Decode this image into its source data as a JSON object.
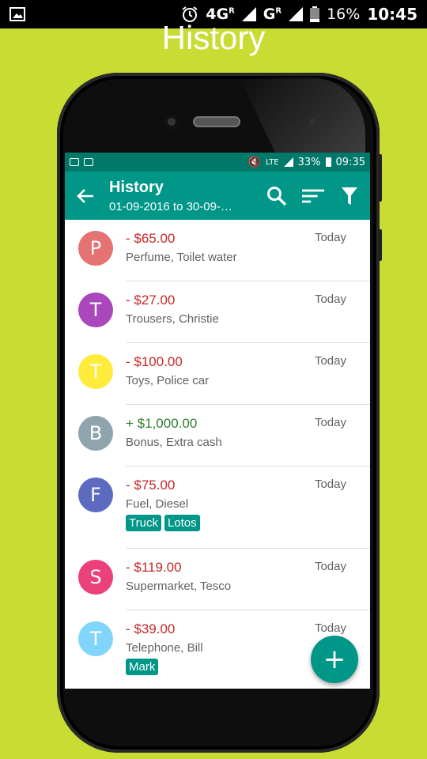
{
  "os_status": {
    "network_1": "4G",
    "network_1_sup": "R",
    "network_2": "G",
    "network_2_sup": "R",
    "battery": "16%",
    "time": "10:45",
    "icons": [
      "image-icon",
      "alarm-icon",
      "signal-icon",
      "battery-icon"
    ]
  },
  "promo_title": "History",
  "app_status": {
    "battery": "33%",
    "time": "09:35",
    "signal_text": "LTE"
  },
  "appbar": {
    "title": "History",
    "subtitle": "01-09-2016 to 30-09-…",
    "icons": [
      "back-arrow-icon",
      "search-icon",
      "sort-icon",
      "filter-icon"
    ]
  },
  "colors": {
    "background": "#c8dc34",
    "primary": "#009688",
    "primary_dark": "#00796b",
    "negative": "#c62828",
    "positive": "#2e7d32"
  },
  "transactions": [
    {
      "initial": "P",
      "avatar_color": "#e57373",
      "amount": "- $65.00",
      "type": "neg",
      "description": "Perfume, Toilet water",
      "date": "Today",
      "tags": []
    },
    {
      "initial": "T",
      "avatar_color": "#ab47bc",
      "amount": "- $27.00",
      "type": "neg",
      "description": "Trousers, Christie",
      "date": "Today",
      "tags": []
    },
    {
      "initial": "T",
      "avatar_color": "#ffeb3b",
      "amount": "- $100.00",
      "type": "neg",
      "description": "Toys, Police car",
      "date": "Today",
      "tags": []
    },
    {
      "initial": "B",
      "avatar_color": "#90a4ae",
      "amount": "+ $1,000.00",
      "type": "pos",
      "description": "Bonus, Extra cash",
      "date": "Today",
      "tags": []
    },
    {
      "initial": "F",
      "avatar_color": "#5c6bc0",
      "amount": "- $75.00",
      "type": "neg",
      "description": "Fuel, Diesel",
      "date": "Today",
      "tags": [
        "Truck",
        "Lotos"
      ]
    },
    {
      "initial": "S",
      "avatar_color": "#ec407a",
      "amount": "- $119.00",
      "type": "neg",
      "description": "Supermarket, Tesco",
      "date": "Today",
      "tags": []
    },
    {
      "initial": "T",
      "avatar_color": "#81d4fa",
      "amount": "- $39.00",
      "type": "neg",
      "description": "Telephone, Bill",
      "date": "Today",
      "tags": [
        "Mark"
      ]
    }
  ],
  "fab": {
    "label": "+",
    "icon": "plus-icon"
  }
}
